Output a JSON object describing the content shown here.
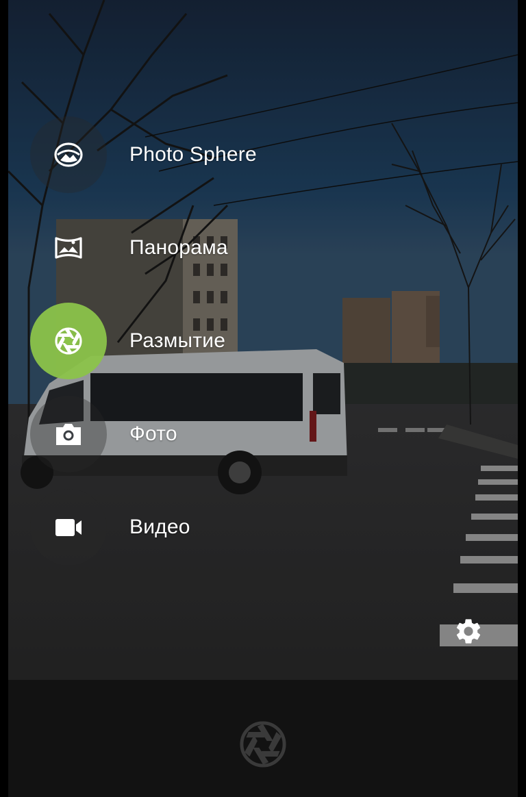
{
  "modes": [
    {
      "label": "Photo Sphere",
      "icon": "photo-sphere-icon",
      "active": false
    },
    {
      "label": "Панорама",
      "icon": "panorama-icon",
      "active": false
    },
    {
      "label": "Размытие",
      "icon": "lens-blur-icon",
      "active": true
    },
    {
      "label": "Фото",
      "icon": "camera-icon",
      "active": false
    },
    {
      "label": "Видео",
      "icon": "video-icon",
      "active": false
    }
  ],
  "colors": {
    "active_accent": "#8BC34A",
    "bottom_bar": "#121212",
    "label_text": "#ffffff"
  },
  "settings": {
    "icon": "gear-icon"
  },
  "shutter": {
    "icon": "lens-blur-shutter-icon"
  }
}
